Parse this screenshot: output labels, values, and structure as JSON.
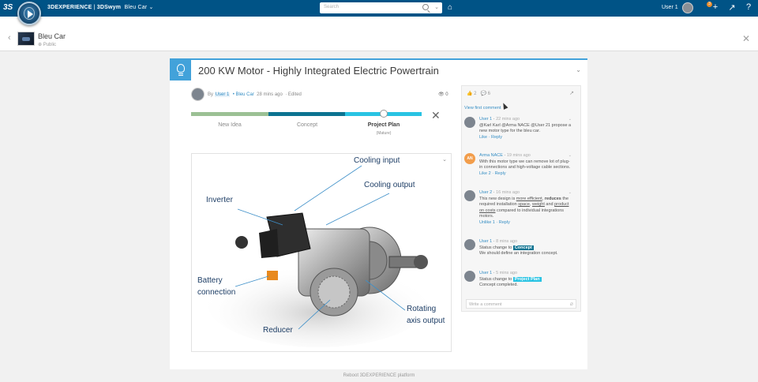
{
  "topbar": {
    "logo_text": "3S",
    "brand": "3DEXPERIENCE",
    "app_sep": " | ",
    "app": "3DSwym",
    "community": "Bleu Car",
    "search_placeholder": "Search",
    "user": "User 1",
    "notification_count": "3",
    "bg_color": "#005386"
  },
  "header": {
    "title": "Bleu Car",
    "subtitle": "Public"
  },
  "idea": {
    "title": "200 KW Motor - Highly Integrated Electric Powertrain",
    "by_prefix": "By",
    "author": "User 1",
    "community": "Bleu Car",
    "time": "28 mins ago",
    "edited": "Edited",
    "views": "0",
    "stages": [
      "New Idea",
      "Concept",
      "Project Plan"
    ],
    "stage_colors": [
      "#9bc094",
      "#0c7391",
      "#29c3e3"
    ],
    "current_stage_sub": "(Mature)",
    "current_stage_fraction": 0.82
  },
  "diagram": {
    "labels": {
      "cooling_input": "Cooling input",
      "cooling_output": "Cooling output",
      "inverter": "Inverter",
      "battery_1": "Battery",
      "battery_2": "connection",
      "rotating_1": "Rotating",
      "rotating_2": "axis output",
      "reducer": "Reducer"
    }
  },
  "panel": {
    "likes": "2",
    "comments_count": "6",
    "view_first": "View first comment",
    "comments": [
      {
        "name": "User 1",
        "time": "22 mins ago",
        "text": "@Karl Karl @Arma NACE @User 21 propose a new motor type for the bleu car.",
        "actions": "Like · Reply"
      },
      {
        "name": "Arma NACE",
        "initials": "AN",
        "time": "19 mins ago",
        "text": "With this motor type we can remove lot of plug-in connections and high-voltage cable sections.",
        "actions": "Like 2 · Reply"
      },
      {
        "name": "User 2",
        "time": "16 mins ago",
        "text_parts": [
          "This new design is ",
          "more efficient",
          ", ",
          "reduces",
          " the required installation ",
          "space",
          ", ",
          "weight",
          " and ",
          "product on costs",
          " compared to individual integrations motors."
        ],
        "actions": "Unlike 1 · Reply"
      },
      {
        "name": "User 1",
        "time": "8 mins ago",
        "status_prefix": "Status change to",
        "status": "Concept",
        "text": "We should define an integration concept.",
        "actions": ""
      },
      {
        "name": "User 1",
        "time": "5 mins ago",
        "status_prefix": "Status change to",
        "status": "Project Plan",
        "text": "Concept completed.",
        "actions": ""
      }
    ],
    "write_placeholder": "Write a comment"
  },
  "footer": "Reboot 3DEXPERIENCE platform"
}
